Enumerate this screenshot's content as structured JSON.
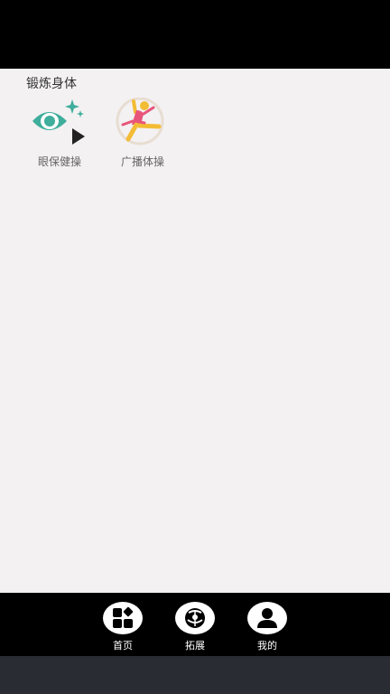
{
  "section": {
    "title": "锻炼身体"
  },
  "activities": [
    {
      "label": "眼保健操",
      "icon": "eye-play-icon",
      "color": "#3fae9c"
    },
    {
      "label": "广播体操",
      "icon": "gymnast-icon",
      "color": "#e8557a"
    }
  ],
  "nav": {
    "items": [
      {
        "label": "首页",
        "icon": "grid-icon"
      },
      {
        "label": "拓展",
        "icon": "ball-icon"
      },
      {
        "label": "我的",
        "icon": "user-icon"
      }
    ]
  }
}
